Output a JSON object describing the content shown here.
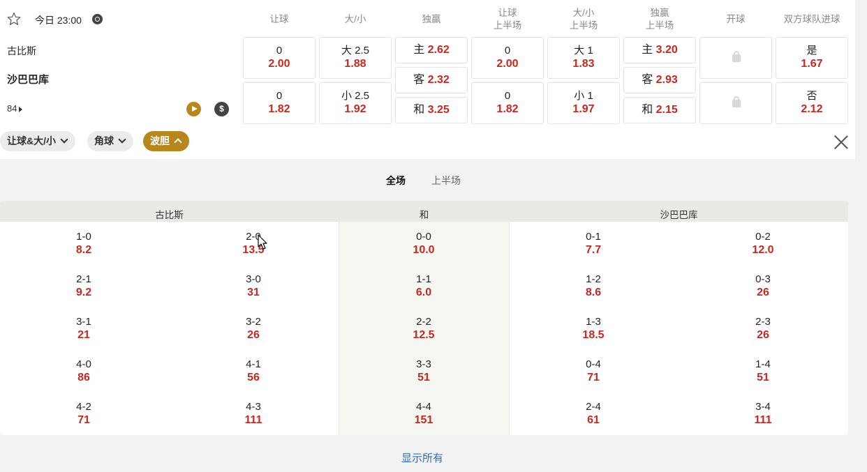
{
  "match": {
    "time": "今日 23:00",
    "home": "古比斯",
    "away": "沙巴巴库",
    "more_markets": "84"
  },
  "columns": [
    {
      "l1": "让球",
      "l2": ""
    },
    {
      "l1": "大/小",
      "l2": ""
    },
    {
      "l1": "独赢",
      "l2": ""
    },
    {
      "l1": "让球",
      "l2": "上半场"
    },
    {
      "l1": "大/小",
      "l2": "上半场"
    },
    {
      "l1": "独赢",
      "l2": "上半场"
    },
    {
      "l1": "开球",
      "l2": ""
    },
    {
      "l1": "双方球队进球",
      "l2": ""
    }
  ],
  "odds": {
    "hcap_home": {
      "label": "0",
      "odd": "2.00"
    },
    "hcap_away": {
      "label": "0",
      "odd": "1.82"
    },
    "ou_over": {
      "label": "大 2.5",
      "odd": "1.88"
    },
    "ou_under": {
      "label": "小 2.5",
      "odd": "1.92"
    },
    "win_home": {
      "label": "主",
      "odd": "2.62"
    },
    "win_away": {
      "label": "客",
      "odd": "2.32"
    },
    "win_draw": {
      "label": "和",
      "odd": "3.25"
    },
    "h1_hcap_home": {
      "label": "0",
      "odd": "2.00"
    },
    "h1_hcap_away": {
      "label": "0",
      "odd": "1.82"
    },
    "h1_ou_over": {
      "label": "大 1",
      "odd": "1.83"
    },
    "h1_ou_under": {
      "label": "小 1",
      "odd": "1.97"
    },
    "h1_win_home": {
      "label": "主",
      "odd": "3.20"
    },
    "h1_win_away": {
      "label": "客",
      "odd": "2.93"
    },
    "h1_win_draw": {
      "label": "和",
      "odd": "2.15"
    },
    "btts_yes": {
      "label": "是",
      "odd": "1.67"
    },
    "btts_no": {
      "label": "否",
      "odd": "2.12"
    }
  },
  "filters": {
    "hcap_ou": "让球&大/小",
    "corners": "角球",
    "correct_score": "波胆"
  },
  "periods": {
    "full": "全场",
    "half": "上半场"
  },
  "cs_headers": {
    "home": "古比斯",
    "draw": "和",
    "away": "沙巴巴库"
  },
  "correct_score": {
    "home_a": [
      {
        "s": "1-0",
        "o": "8.2"
      },
      {
        "s": "2-1",
        "o": "9.2"
      },
      {
        "s": "3-1",
        "o": "21"
      },
      {
        "s": "4-0",
        "o": "86"
      },
      {
        "s": "4-2",
        "o": "71"
      }
    ],
    "home_b": [
      {
        "s": "2-0",
        "o": "13.5"
      },
      {
        "s": "3-0",
        "o": "31"
      },
      {
        "s": "3-2",
        "o": "26"
      },
      {
        "s": "4-1",
        "o": "56"
      },
      {
        "s": "4-3",
        "o": "111"
      }
    ],
    "draw": [
      {
        "s": "0-0",
        "o": "10.0"
      },
      {
        "s": "1-1",
        "o": "6.0"
      },
      {
        "s": "2-2",
        "o": "12.5"
      },
      {
        "s": "3-3",
        "o": "51"
      },
      {
        "s": "4-4",
        "o": "151"
      }
    ],
    "away_a": [
      {
        "s": "0-1",
        "o": "7.7"
      },
      {
        "s": "1-2",
        "o": "8.6"
      },
      {
        "s": "1-3",
        "o": "18.5"
      },
      {
        "s": "0-4",
        "o": "71"
      },
      {
        "s": "2-4",
        "o": "61"
      }
    ],
    "away_b": [
      {
        "s": "0-2",
        "o": "12.0"
      },
      {
        "s": "0-3",
        "o": "26"
      },
      {
        "s": "2-3",
        "o": "26"
      },
      {
        "s": "1-4",
        "o": "51"
      },
      {
        "s": "3-4",
        "o": "111"
      }
    ]
  },
  "show_all": "显示所有",
  "icons": {
    "favorite": "star-icon",
    "clock": "clock-icon",
    "video": "play-icon",
    "cashout": "dollar-icon",
    "locked": "lock-icon",
    "close": "close-icon"
  },
  "colors": {
    "odds": "#c8281e",
    "accent": "#b8861e",
    "link": "#2a6fc0"
  }
}
